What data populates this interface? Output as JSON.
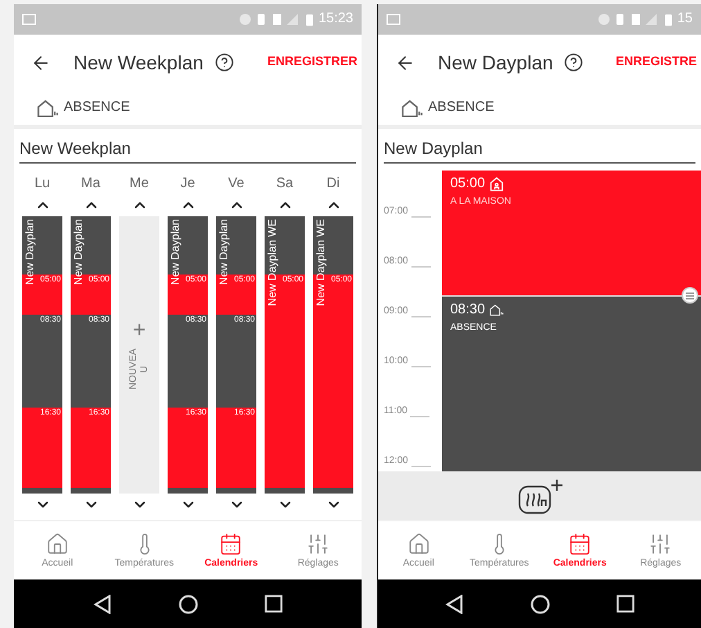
{
  "screens": [
    {
      "kind": "week",
      "status_time": "15:23",
      "title": "New Weekplan",
      "save": "ENREGISTRER",
      "mode_label": "ABSENCE",
      "name_field": "New Weekplan",
      "days": [
        {
          "label": "Lu",
          "kind": "plan",
          "plan": "New Dayplan",
          "segments": [
            {
              "color": "#4d4d4d"
            },
            {
              "color": "#ff1020",
              "time": "05:00"
            },
            {
              "color": "#4d4d4d",
              "time": "08:30"
            },
            {
              "color": "#ff1020",
              "time": "16:30"
            },
            {
              "color": "#4d4d4d"
            }
          ]
        },
        {
          "label": "Ma",
          "kind": "plan",
          "plan": "New Dayplan",
          "segments": [
            {
              "color": "#4d4d4d"
            },
            {
              "color": "#ff1020",
              "time": "05:00"
            },
            {
              "color": "#4d4d4d",
              "time": "08:30"
            },
            {
              "color": "#ff1020",
              "time": "16:30"
            },
            {
              "color": "#4d4d4d"
            }
          ]
        },
        {
          "label": "Me",
          "kind": "empty",
          "plus": "+",
          "empty_label": "NOUVEAU"
        },
        {
          "label": "Je",
          "kind": "plan",
          "plan": "New Dayplan",
          "segments": [
            {
              "color": "#4d4d4d"
            },
            {
              "color": "#ff1020",
              "time": "05:00"
            },
            {
              "color": "#4d4d4d",
              "time": "08:30"
            },
            {
              "color": "#ff1020",
              "time": "16:30"
            },
            {
              "color": "#4d4d4d"
            }
          ]
        },
        {
          "label": "Ve",
          "kind": "plan",
          "plan": "New Dayplan",
          "segments": [
            {
              "color": "#4d4d4d"
            },
            {
              "color": "#ff1020",
              "time": "05:00"
            },
            {
              "color": "#4d4d4d",
              "time": "08:30"
            },
            {
              "color": "#ff1020",
              "time": "16:30"
            },
            {
              "color": "#4d4d4d"
            }
          ]
        },
        {
          "label": "Sa",
          "kind": "plan",
          "plan": "New Dayplan WE",
          "segments": [
            {
              "color": "#4d4d4d"
            },
            {
              "color": "#ff1020",
              "time": "05:00"
            },
            {
              "color": "#4d4d4d"
            }
          ]
        },
        {
          "label": "Di",
          "kind": "plan",
          "plan": "New Dayplan WE",
          "segments": [
            {
              "color": "#4d4d4d"
            },
            {
              "color": "#ff1020",
              "time": "05:00"
            },
            {
              "color": "#4d4d4d"
            }
          ]
        }
      ],
      "nav": [
        {
          "label": "Accueil",
          "selected": false
        },
        {
          "label": "Températures",
          "selected": false
        },
        {
          "label": "Calendriers",
          "selected": true
        },
        {
          "label": "Réglages",
          "selected": false
        }
      ]
    },
    {
      "kind": "day",
      "status_time": "15",
      "title": "New Dayplan",
      "save": "ENREGISTRE",
      "mode_label": "ABSENCE",
      "name_field": "New Dayplan",
      "hours": [
        "07:00",
        "08:00",
        "09:00",
        "10:00",
        "11:00",
        "12:00"
      ],
      "blocks": [
        {
          "kind": "home",
          "time": "05:00",
          "label": "A LA MAISON"
        },
        {
          "kind": "away",
          "time": "08:30",
          "label": "ABSENCE"
        }
      ],
      "nav": [
        {
          "label": "Accueil",
          "selected": false
        },
        {
          "label": "Températures",
          "selected": false
        },
        {
          "label": "Calendriers",
          "selected": true
        },
        {
          "label": "Réglages",
          "selected": false
        }
      ]
    }
  ]
}
